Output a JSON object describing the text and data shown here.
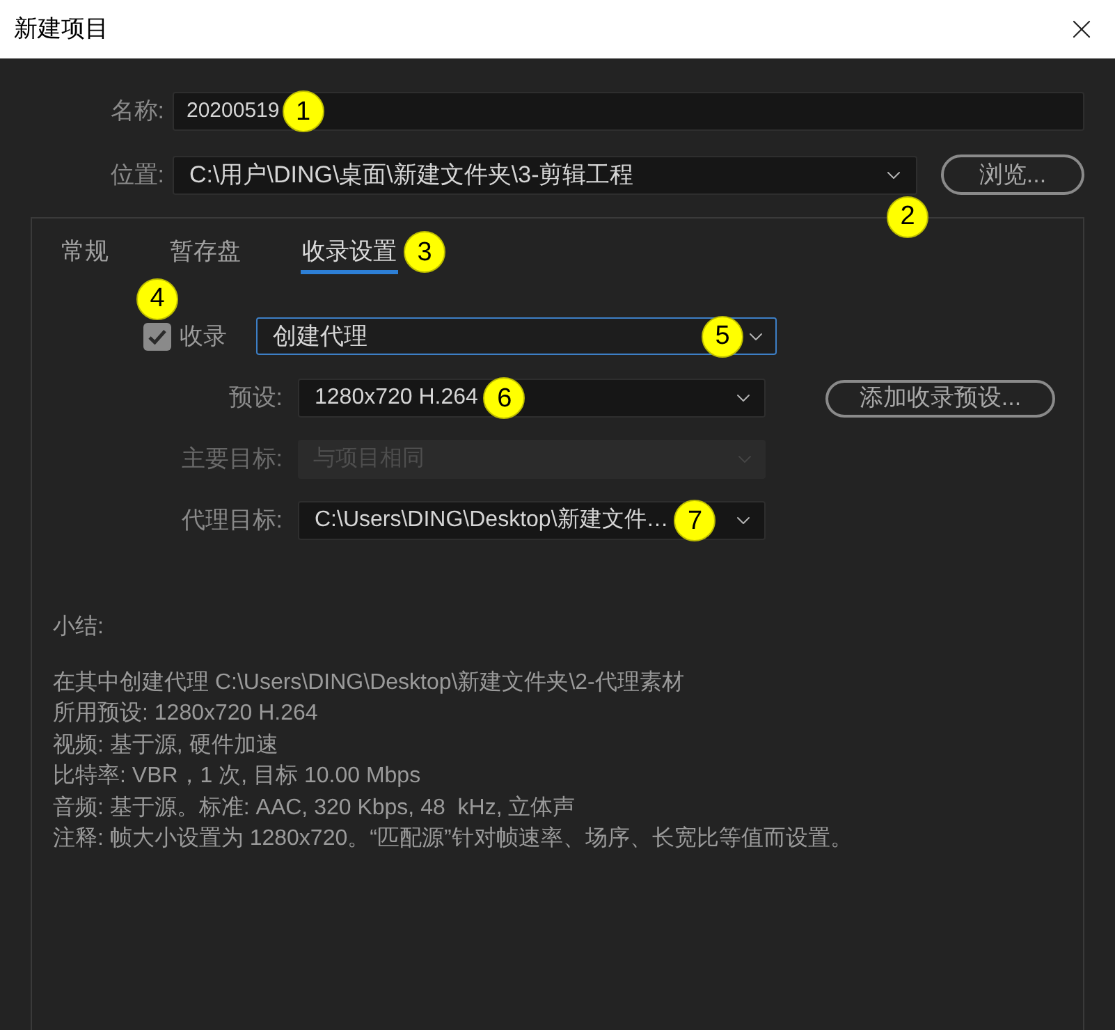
{
  "window": {
    "title": "新建项目"
  },
  "name_field": {
    "label": "名称:",
    "value": "20200519",
    "annotation": "1"
  },
  "location_field": {
    "label": "位置:",
    "value": "C:\\用户\\DING\\桌面\\新建文件夹\\3-剪辑工程",
    "annotation": "2",
    "button": "浏览..."
  },
  "tabs": [
    {
      "label": "常规",
      "selected": false
    },
    {
      "label": "暂存盘",
      "selected": false
    },
    {
      "label": "收录设置",
      "selected": true,
      "annotation": "3"
    }
  ],
  "ingest": {
    "label": "收录",
    "checked": true,
    "annotation": "4",
    "mode": {
      "value": "创建代理",
      "focused": true,
      "annotation": "5"
    }
  },
  "settings": [
    {
      "label": "预设:",
      "value": "1280x720 H.264",
      "disabled": false,
      "annotation": "6",
      "button": "添加收录预设..."
    },
    {
      "label": "主要目标:",
      "value": "与项目相同",
      "disabled": true
    },
    {
      "label": "代理目标:",
      "value": "C:\\Users\\DING\\Desktop\\新建文件…",
      "disabled": false,
      "annotation": "7"
    }
  ],
  "summary": {
    "heading": "小结:",
    "lines": [
      "在其中创建代理 C:\\Users\\DING\\Desktop\\新建文件夹\\2-代理素材",
      "所用预设: 1280x720 H.264",
      "视频: 基于源, 硬件加速",
      "比特率: VBR，1 次, 目标 10.00 Mbps",
      "音频: 基于源。标准: AAC, 320 Kbps, 48  kHz, 立体声",
      "注释: 帧大小设置为 1280x720。“匹配源”针对帧速率、场序、长宽比等值而设置。"
    ]
  }
}
